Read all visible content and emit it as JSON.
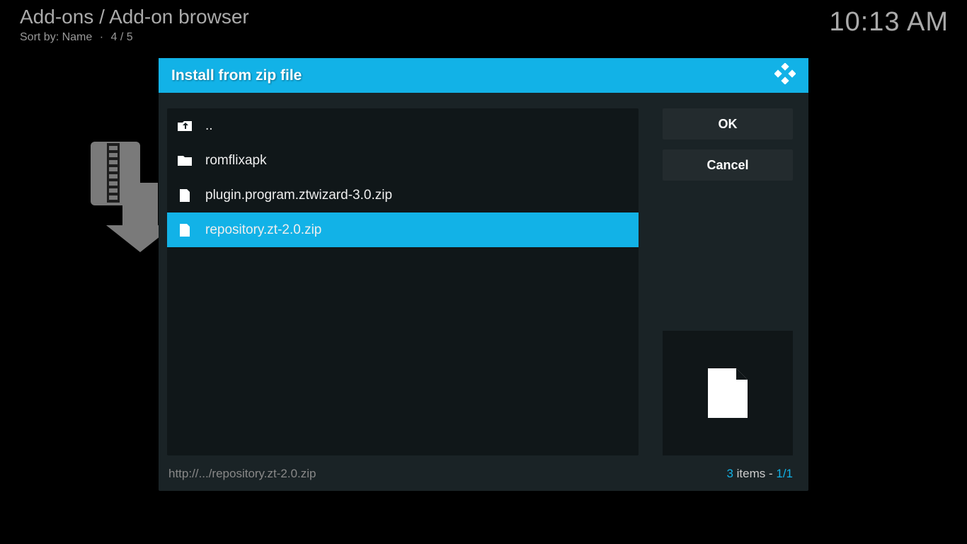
{
  "header": {
    "breadcrumb": "Add-ons / Add-on browser",
    "sort_label": "Sort by: Name",
    "position": "4 / 5"
  },
  "clock": "10:13 AM",
  "dialog": {
    "title": "Install from zip file",
    "files": [
      {
        "icon": "folder-up",
        "label": "..",
        "selected": false
      },
      {
        "icon": "folder",
        "label": "romflixapk",
        "selected": false
      },
      {
        "icon": "file",
        "label": "plugin.program.ztwizard-3.0.zip",
        "selected": false
      },
      {
        "icon": "file",
        "label": "repository.zt-2.0.zip",
        "selected": true
      }
    ],
    "ok_label": "OK",
    "cancel_label": "Cancel",
    "path": "http://.../repository.zt-2.0.zip",
    "count_number": "3",
    "count_word": " items - ",
    "page": "1/1"
  }
}
